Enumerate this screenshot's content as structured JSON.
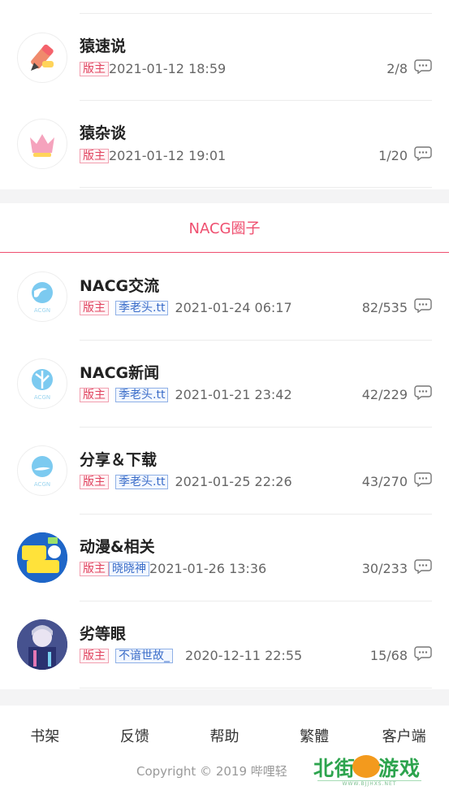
{
  "section": {
    "title": "NACG圈子"
  },
  "top_forums": [
    {
      "name": "猿速说",
      "badges": [
        "版主"
      ],
      "time": "2021-01-12 18:59",
      "count": "2/8",
      "avatar": "pencil-icon"
    },
    {
      "name": "猿杂谈",
      "badges": [
        "版主"
      ],
      "time": "2021-01-12 19:01",
      "count": "1/20",
      "avatar": "crown-icon"
    }
  ],
  "nacg_forums": [
    {
      "name": "NACG交流",
      "badges": [
        "版主",
        "季老头.tt"
      ],
      "time": "2021-01-24 06:17",
      "count": "82/535",
      "avatar": "acgn-logo"
    },
    {
      "name": "NACG新闻",
      "badges": [
        "版主",
        "季老头.tt"
      ],
      "time": "2021-01-21 23:42",
      "count": "42/229",
      "avatar": "acgn-logo"
    },
    {
      "name": "分享＆下载",
      "badges": [
        "版主",
        "季老头.tt"
      ],
      "time": "2021-01-25 22:26",
      "count": "43/270",
      "avatar": "acgn-logo"
    },
    {
      "name": "动漫&相关",
      "badges": [
        "版主",
        "晓晓神"
      ],
      "time": "2021-01-26 13:36",
      "count": "30/233",
      "avatar": "anime-avatar"
    },
    {
      "name": "劣等眼",
      "badges": [
        "版主",
        "不谙世故_"
      ],
      "time": "2020-12-11 22:55",
      "count": "15/68",
      "avatar": "character-avatar"
    }
  ],
  "footer": {
    "links": [
      "书架",
      "反馈",
      "帮助",
      "繁體",
      "客户端"
    ],
    "copyright": "Copyright © 2019 哔哩轻"
  },
  "watermark": {
    "main_left": "北街",
    "main_right": "游戏",
    "sub": "WWW.BJJHXS.NET"
  },
  "colors": {
    "accent": "#ef4f6f",
    "mod_badge": "#e0435f",
    "user_badge": "#3a6cc8",
    "progress": "#7fd0c0"
  }
}
